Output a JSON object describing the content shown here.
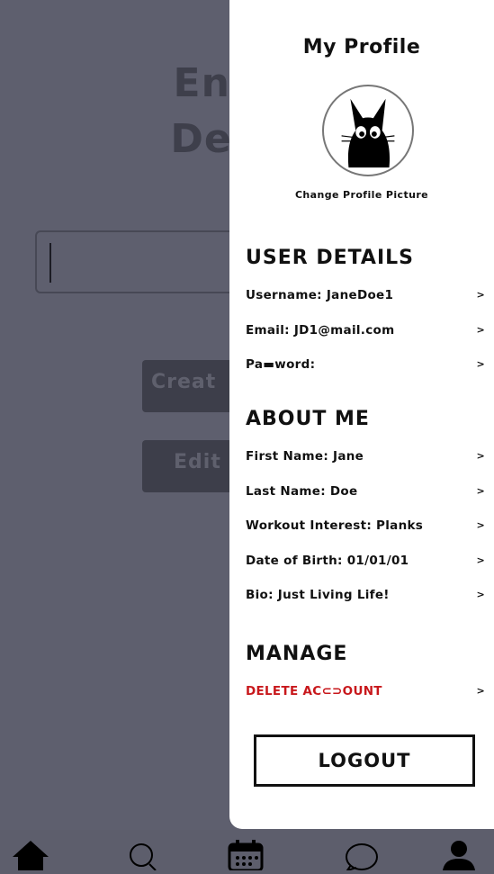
{
  "background": {
    "title_line1": "Enter",
    "title_line2": "Descr",
    "create_label": "Creat",
    "edit_label": "Edit"
  },
  "drawer": {
    "title": "My Profile",
    "change_picture": "Change Profile Picture",
    "sections": {
      "user_details": "USER DETAILS",
      "about_me": "ABOUT ME",
      "manage": "MANAGE"
    },
    "user_details": [
      {
        "label": "Username: JaneDoe1",
        "chevron": ">"
      },
      {
        "label": "Email: JD1@mail.com",
        "chevron": ">"
      },
      {
        "label": "Pa▬word:",
        "chevron": ">"
      }
    ],
    "about_me": [
      {
        "label": "First Name: Jane",
        "chevron": ">"
      },
      {
        "label": "Last Name: Doe",
        "chevron": ">"
      },
      {
        "label": "Workout Interest: Planks",
        "chevron": ">"
      },
      {
        "label": "Date of Birth: 01/01/01",
        "chevron": ">"
      },
      {
        "label": "Bio: Just Living Life!",
        "chevron": ">"
      }
    ],
    "manage": [
      {
        "label": "DELETE AC⊂⊃OUNT",
        "chevron": ">"
      }
    ],
    "logout_label": "LOGOUT"
  },
  "tabbar": {
    "icons": [
      "home-icon",
      "search-icon",
      "calendar-icon",
      "chat-icon",
      "profile-icon"
    ]
  },
  "colors": {
    "overlay": "#5e5f6e",
    "drawer": "#ffffff",
    "danger": "#c8181c",
    "text": "#111111"
  }
}
